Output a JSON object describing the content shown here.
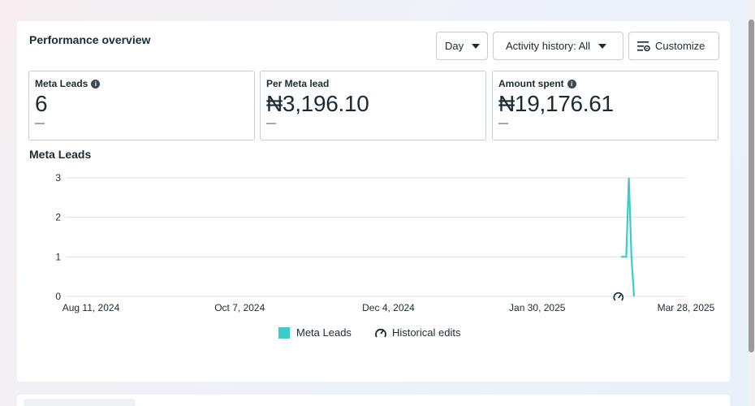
{
  "header": {
    "title": "Performance overview",
    "day_label": "Day",
    "activity_label": "Activity history: All",
    "customize_label": "Customize"
  },
  "metrics": [
    {
      "label": "Meta Leads",
      "value": "6",
      "sub": "—",
      "info": true
    },
    {
      "label": "Per Meta lead",
      "value": "₦3,196.10",
      "sub": "—",
      "info": false
    },
    {
      "label": "Amount spent",
      "value": "₦19,176.61",
      "sub": "—",
      "info": true
    }
  ],
  "chart_title": "Meta Leads",
  "legend": {
    "series_label": "Meta Leads",
    "edits_label": "Historical edits"
  },
  "colors": {
    "series": "#3acccc",
    "grid": "#dddfe2",
    "text": "#1c2b33"
  },
  "chart_data": {
    "type": "line",
    "title": "Meta Leads",
    "xlabel": "",
    "ylabel": "",
    "x_ticks": [
      "Aug 11, 2024",
      "Oct 7, 2024",
      "Dec 4, 2024",
      "Jan 30, 2025",
      "Mar 28, 2025"
    ],
    "x_range": [
      "2024-08-11",
      "2025-03-28"
    ],
    "ylim": [
      0,
      3
    ],
    "y_ticks": [
      0,
      1,
      2,
      3
    ],
    "grid": true,
    "legend_position": "bottom",
    "series": [
      {
        "name": "Meta Leads",
        "points": [
          {
            "x": "2025-03-03",
            "y": 1
          },
          {
            "x": "2025-03-04",
            "y": 1
          },
          {
            "x": "2025-03-05",
            "y": 1
          },
          {
            "x": "2025-03-06",
            "y": 3
          },
          {
            "x": "2025-03-07",
            "y": 1
          },
          {
            "x": "2025-03-08",
            "y": 0
          }
        ]
      }
    ],
    "annotations": [
      {
        "type": "historical-edit",
        "x": "2025-03-02"
      }
    ]
  }
}
